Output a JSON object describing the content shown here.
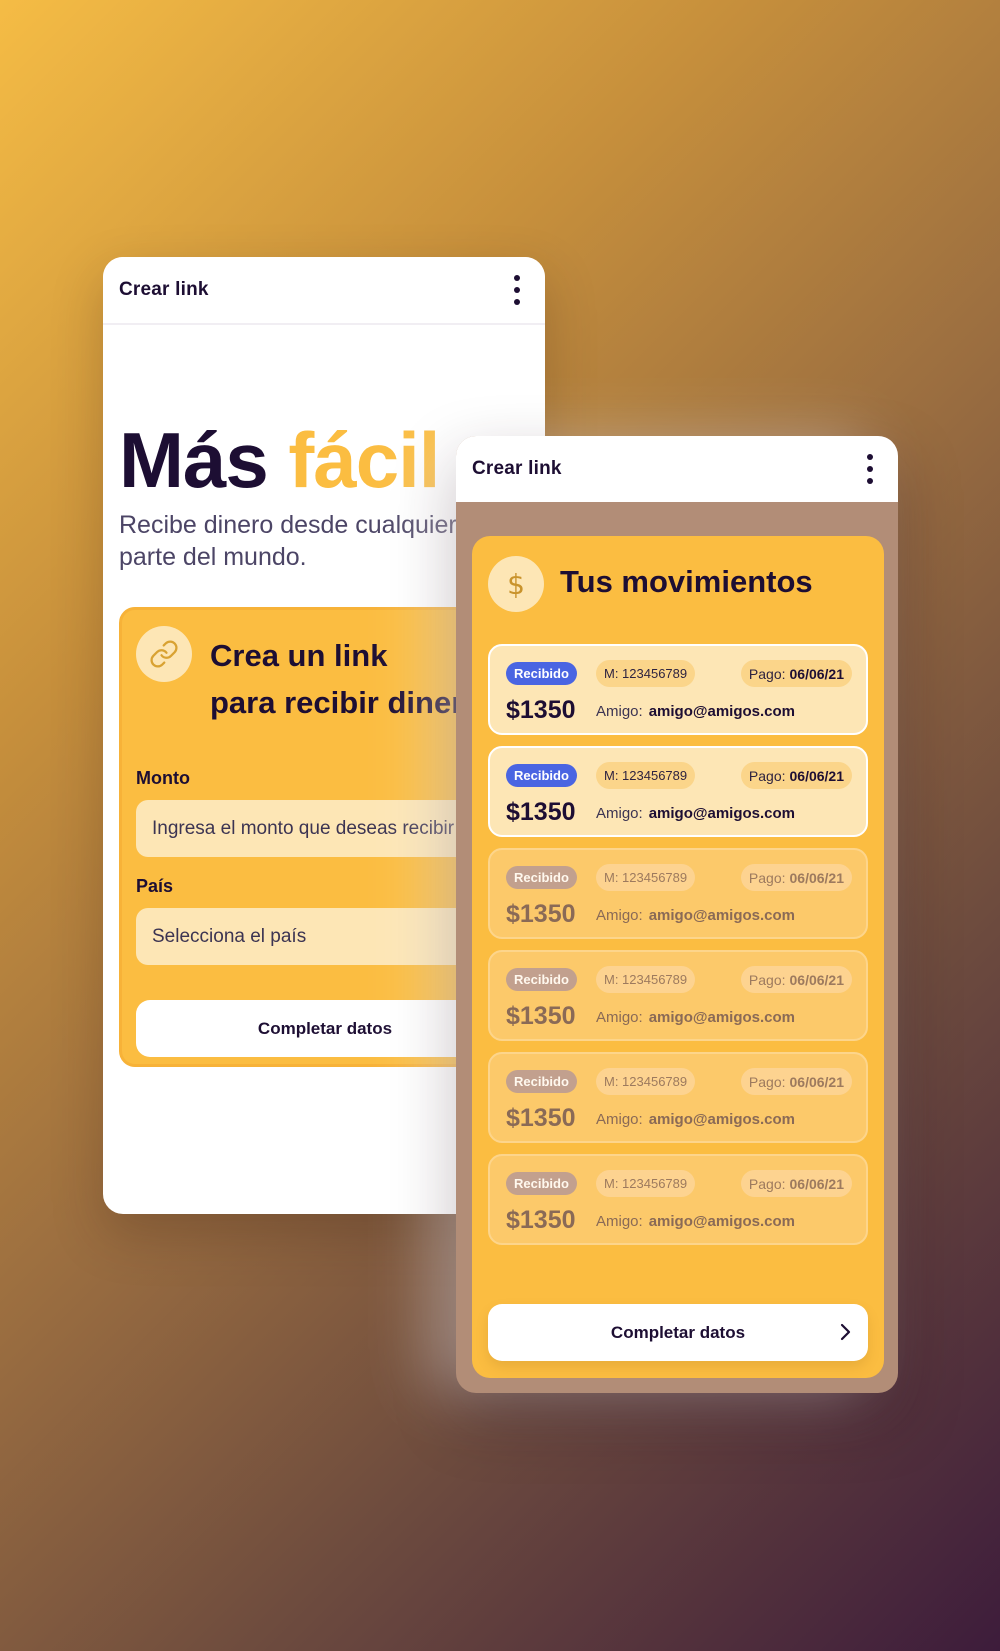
{
  "back_screen": {
    "header": {
      "title": "Crear link"
    },
    "hero": {
      "title_main": "Más ",
      "title_accent": "fácil",
      "subtitle_line1": "Recibe dinero desde cualquier",
      "subtitle_line2": "parte del mundo."
    },
    "form": {
      "title_line1": "Crea un link",
      "title_line2": "para recibir dinero",
      "amount_label": "Monto",
      "amount_placeholder": "Ingresa el monto que deseas recibir",
      "country_label": "País",
      "country_placeholder": "Selecciona el país",
      "submit_label": "Completar datos"
    }
  },
  "front_screen": {
    "header": {
      "title": "Crear link"
    },
    "panel_title": "Tus movimientos",
    "dollar_symbol": "$",
    "transactions": [
      {
        "status": "Recibido",
        "ref": "M: 123456789",
        "pago_label": "Pago:",
        "pago_date": "06/06/21",
        "amount": "$1350",
        "friend_label": "Amigo:",
        "friend_email": "amigo@amigos.com"
      },
      {
        "status": "Recibido",
        "ref": "M: 123456789",
        "pago_label": "Pago:",
        "pago_date": "06/06/21",
        "amount": "$1350",
        "friend_label": "Amigo:",
        "friend_email": "amigo@amigos.com"
      },
      {
        "status": "Recibido",
        "ref": "M: 123456789",
        "pago_label": "Pago:",
        "pago_date": "06/06/21",
        "amount": "$1350",
        "friend_label": "Amigo:",
        "friend_email": "amigo@amigos.com"
      },
      {
        "status": "Recibido",
        "ref": "M: 123456789",
        "pago_label": "Pago:",
        "pago_date": "06/06/21",
        "amount": "$1350",
        "friend_label": "Amigo:",
        "friend_email": "amigo@amigos.com"
      },
      {
        "status": "Recibido",
        "ref": "M: 123456789",
        "pago_label": "Pago:",
        "pago_date": "06/06/21",
        "amount": "$1350",
        "friend_label": "Amigo:",
        "friend_email": "amigo@amigos.com"
      },
      {
        "status": "Recibido",
        "ref": "M: 123456789",
        "pago_label": "Pago:",
        "pago_date": "06/06/21",
        "amount": "$1350",
        "friend_label": "Amigo:",
        "friend_email": "amigo@amigos.com"
      }
    ],
    "submit_label": "Completar datos"
  },
  "icons": {
    "menu": "kebab-menu-icon",
    "link": "link-icon",
    "dollar": "dollar-icon",
    "chevron": "chevron-right-icon"
  },
  "colors": {
    "brand_yellow": "#fbbd41",
    "brand_dark": "#1d0e33",
    "badge_blue": "#4a65e2",
    "input_light": "#fde6b5"
  }
}
